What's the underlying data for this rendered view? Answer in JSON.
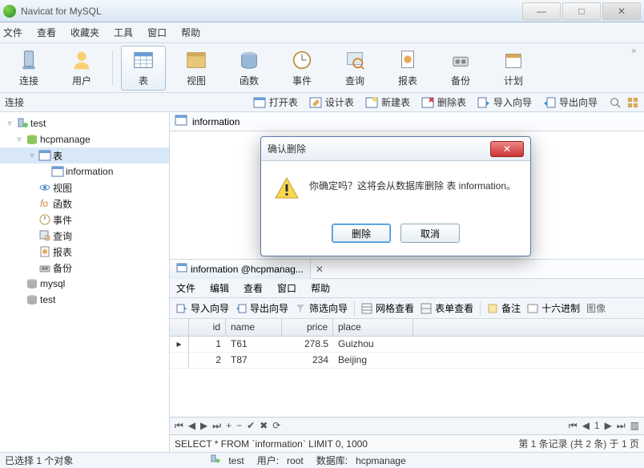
{
  "window": {
    "title": "Navicat for MySQL"
  },
  "menu": {
    "file": "文件",
    "view": "查看",
    "fav": "收藏夹",
    "tools": "工具",
    "window": "窗口",
    "help": "帮助"
  },
  "toolbar": {
    "connect": "连接",
    "user": "用户",
    "table": "表",
    "viewobj": "视图",
    "func": "函数",
    "event": "事件",
    "query": "查询",
    "report": "报表",
    "backup": "备份",
    "schedule": "计划"
  },
  "connbar": {
    "label": "连接",
    "open_table": "打开表",
    "design_table": "设计表",
    "new_table": "新建表",
    "delete_table": "删除表",
    "import": "导入向导",
    "export": "导出向导"
  },
  "tree": {
    "test": "test",
    "hcpmanage": "hcpmanage",
    "tables": "表",
    "information": "information",
    "views": "视图",
    "funcs": "函数",
    "events": "事件",
    "queries": "查询",
    "reports": "报表",
    "backups": "备份",
    "mysql": "mysql",
    "test2": "test"
  },
  "obj_header": {
    "name": "information"
  },
  "dialog": {
    "title": "确认删除",
    "message": "你确定吗？这将会从数据库删除 表 information。",
    "delete": "删除",
    "cancel": "取消"
  },
  "data_tab": {
    "label": "information @hcpmanag..."
  },
  "data_menu": {
    "file": "文件",
    "edit": "编辑",
    "view": "查看",
    "window": "窗口",
    "help": "帮助"
  },
  "data_toolbar": {
    "import": "导入向导",
    "export": "导出向导",
    "filter": "筛选向导",
    "gridview": "网格查看",
    "formview": "表单查看",
    "note": "备注",
    "hex": "十六进制",
    "image": "图像"
  },
  "grid": {
    "cols": {
      "id": "id",
      "name": "name",
      "price": "price",
      "place": "place"
    },
    "rows": [
      {
        "id": "1",
        "name": "T61",
        "price": "278.5",
        "place": "Guizhou"
      },
      {
        "id": "2",
        "name": "T87",
        "price": "234",
        "place": "Beijing"
      }
    ]
  },
  "sql": "SELECT * FROM `information` LIMIT 0, 1000",
  "record_info": "第 1 条记录 (共 2 条) 于 1 页",
  "status": {
    "selection": "已选择 1 个对象",
    "conn": "test",
    "user_label": "用户: ",
    "user": "root",
    "db_label": "数据库: ",
    "db": "hcpmanage"
  }
}
